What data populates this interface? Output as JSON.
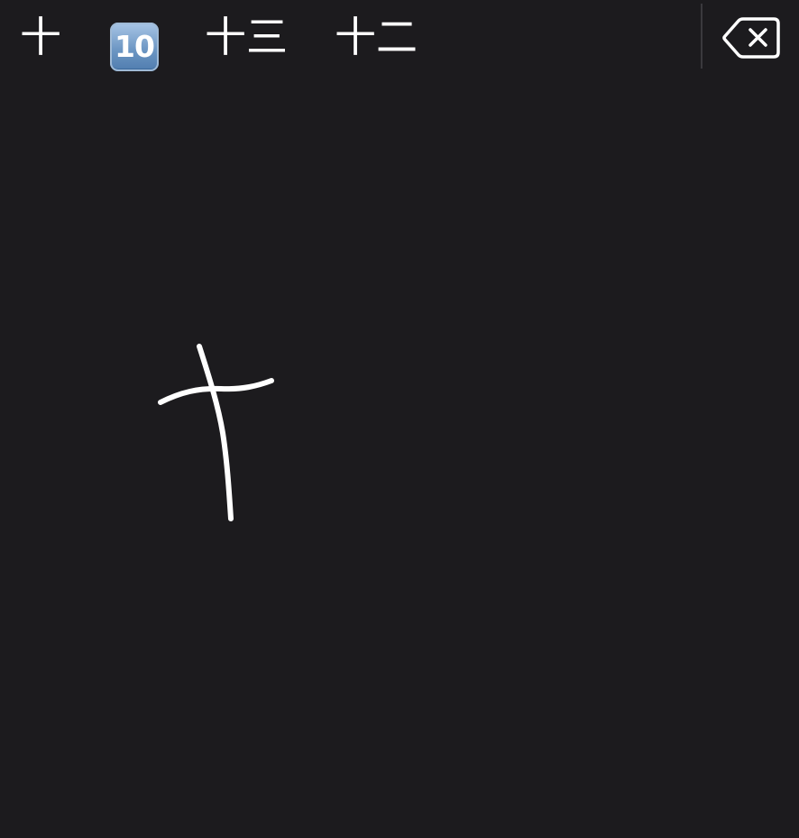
{
  "keyboard": {
    "background": "#1c1b1e",
    "candidates": [
      {
        "label": "十"
      },
      {
        "label": "10",
        "icon": "keycap-ten-emoji"
      },
      {
        "label": "十三"
      },
      {
        "label": "十二"
      }
    ],
    "delete_icon": "delete-backspace-icon",
    "stroke_color": "#ffffff"
  }
}
